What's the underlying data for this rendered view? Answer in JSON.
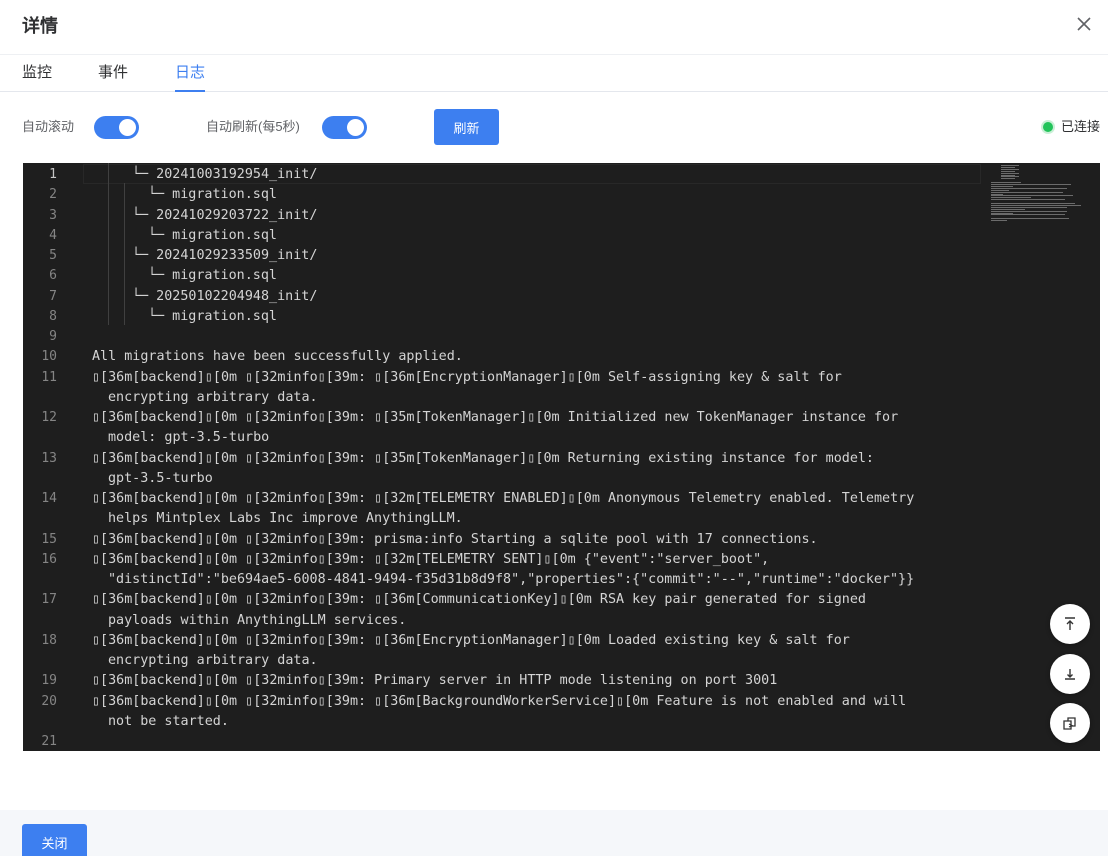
{
  "dialog": {
    "title": "详情",
    "close_icon": "close-icon"
  },
  "tabs": [
    {
      "label": "监控",
      "active": false
    },
    {
      "label": "事件",
      "active": false
    },
    {
      "label": "日志",
      "active": true
    }
  ],
  "toolbar": {
    "auto_scroll_label": "自动滚动",
    "auto_scroll_on": true,
    "auto_refresh_label": "自动刷新(每5秒)",
    "auto_refresh_on": true,
    "refresh_label": "刷新",
    "status_label": "已连接",
    "status_color": "#22c35a",
    "accent_color": "#3d7ff0"
  },
  "log": {
    "current_line": 1,
    "lines": [
      {
        "n": "1",
        "text": "└─ 20241003192954_init/"
      },
      {
        "n": "2",
        "text": "└─ migration.sql"
      },
      {
        "n": "3",
        "text": "└─ 20241029203722_init/"
      },
      {
        "n": "4",
        "text": "└─ migration.sql"
      },
      {
        "n": "5",
        "text": "└─ 20241029233509_init/"
      },
      {
        "n": "6",
        "text": "└─ migration.sql"
      },
      {
        "n": "7",
        "text": "└─ 20250102204948_init/"
      },
      {
        "n": "8",
        "text": "└─ migration.sql"
      },
      {
        "n": "9",
        "text": ""
      },
      {
        "n": "10",
        "text": "All migrations have been successfully applied."
      },
      {
        "n": "11",
        "text": "\u0000[36m[backend]\u0000[0m \u0000[32minfo\u0000[39m: \u0000[36m[EncryptionManager]\u0000[0m Self-assigning key & salt for",
        "cont": "encrypting arbitrary data."
      },
      {
        "n": "12",
        "text": "\u0000[36m[backend]\u0000[0m \u0000[32minfo\u0000[39m: \u0000[35m[TokenManager]\u0000[0m Initialized new TokenManager instance for",
        "cont": "model: gpt-3.5-turbo"
      },
      {
        "n": "13",
        "text": "\u0000[36m[backend]\u0000[0m \u0000[32minfo\u0000[39m: \u0000[35m[TokenManager]\u0000[0m Returning existing instance for model:",
        "cont": "gpt-3.5-turbo"
      },
      {
        "n": "14",
        "text": "\u0000[36m[backend]\u0000[0m \u0000[32minfo\u0000[39m: \u0000[32m[TELEMETRY ENABLED]\u0000[0m Anonymous Telemetry enabled. Telemetry",
        "cont": "helps Mintplex Labs Inc improve AnythingLLM."
      },
      {
        "n": "15",
        "text": "\u0000[36m[backend]\u0000[0m \u0000[32minfo\u0000[39m: prisma:info Starting a sqlite pool with 17 connections."
      },
      {
        "n": "16",
        "text": "\u0000[36m[backend]\u0000[0m \u0000[32minfo\u0000[39m: \u0000[32m[TELEMETRY SENT]\u0000[0m {\"event\":\"server_boot\",",
        "cont": "\"distinctId\":\"be694ae5-6008-4841-9494-f35d31b8d9f8\",\"properties\":{\"commit\":\"--\",\"runtime\":\"docker\"}}"
      },
      {
        "n": "17",
        "text": "\u0000[36m[backend]\u0000[0m \u0000[32minfo\u0000[39m: \u0000[36m[CommunicationKey]\u0000[0m RSA key pair generated for signed",
        "cont": "payloads within AnythingLLM services."
      },
      {
        "n": "18",
        "text": "\u0000[36m[backend]\u0000[0m \u0000[32minfo\u0000[39m: \u0000[36m[EncryptionManager]\u0000[0m Loaded existing key & salt for",
        "cont": "encrypting arbitrary data."
      },
      {
        "n": "19",
        "text": "\u0000[36m[backend]\u0000[0m \u0000[32minfo\u0000[39m: Primary server in HTTP mode listening on port 3001"
      },
      {
        "n": "20",
        "text": "\u0000[36m[backend]\u0000[0m \u0000[32minfo\u0000[39m: \u0000[36m[BackgroundWorkerService]\u0000[0m Feature is not enabled and will",
        "cont": "not be started."
      },
      {
        "n": "21",
        "text": ""
      }
    ]
  },
  "scroll_buttons": [
    {
      "name": "scroll-top-button",
      "icon": "arrow-to-top-icon"
    },
    {
      "name": "scroll-bottom-button",
      "icon": "arrow-to-bottom-icon"
    },
    {
      "name": "copy-button",
      "icon": "copy-icon"
    }
  ],
  "footer": {
    "close_label": "关闭"
  }
}
